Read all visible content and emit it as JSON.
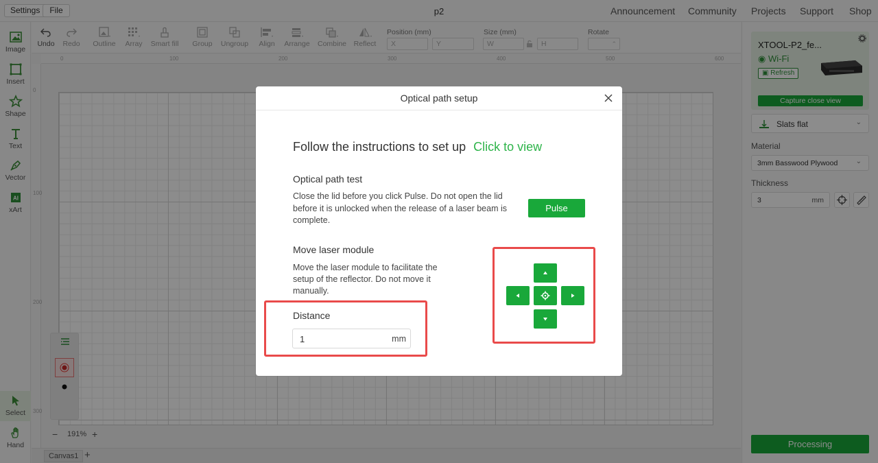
{
  "topbar": {
    "settings_label": "Settings",
    "file_label": "File",
    "title": "p2",
    "nav": [
      "Announcement",
      "Community",
      "Projects",
      "Support",
      "Shop"
    ]
  },
  "leftrail": {
    "tools": [
      {
        "label": "Image",
        "icon": "image-icon"
      },
      {
        "label": "Insert",
        "icon": "insert-icon"
      },
      {
        "label": "Shape",
        "icon": "shape-icon"
      },
      {
        "label": "Text",
        "icon": "text-icon"
      },
      {
        "label": "Vector",
        "icon": "vector-pen-icon"
      },
      {
        "label": "xArt",
        "icon": "ai-art-icon"
      }
    ],
    "bottom_tools": [
      {
        "label": "Select",
        "icon": "cursor-icon"
      },
      {
        "label": "Hand",
        "icon": "hand-icon"
      }
    ]
  },
  "toolbar": {
    "undo": "Undo",
    "redo": "Redo",
    "outline": "Outline",
    "array": "Array",
    "smart_fill": "Smart fill",
    "group": "Group",
    "ungroup": "Ungroup",
    "align": "Align",
    "arrange": "Arrange",
    "combine": "Combine",
    "reflect": "Reflect",
    "position_label": "Position (mm)",
    "position_x": "X",
    "position_y": "Y",
    "size_label": "Size (mm)",
    "size_w": "W",
    "size_h": "H",
    "rotate_label": "Rotate"
  },
  "rulers": {
    "h": [
      "0",
      "100",
      "200",
      "300",
      "400",
      "500",
      "600"
    ],
    "v": [
      "0",
      "100",
      "200",
      "300"
    ]
  },
  "canvas": {
    "zoom": "191%",
    "tab": "Canvas1"
  },
  "rightpanel": {
    "device_name": "XTOOL-P2_fe...",
    "connection": "Wi-Fi",
    "refresh": "Refresh",
    "capture": "Capture close view",
    "platform": "Slats flat",
    "material_label": "Material",
    "material_value": "3mm Basswood Plywood",
    "thickness_label": "Thickness",
    "thickness_value": "3",
    "thickness_unit": "mm",
    "processing": "Processing"
  },
  "modal": {
    "title": "Optical path setup",
    "instructions": "Follow the instructions to set up",
    "click_to_view": "Click to view",
    "test_heading": "Optical path test",
    "test_text": "Close the lid before you click Pulse. Do not open the lid before it is unlocked when the release of a laser beam is complete.",
    "pulse": "Pulse",
    "move_heading": "Move laser module",
    "move_text": "Move the laser module to facilitate the setup of the reflector. Do not move it manually.",
    "distance_label": "Distance",
    "distance_value": "1",
    "distance_unit": "mm"
  },
  "colors": {
    "accent": "#19a83a",
    "highlight": "#e94a4a"
  }
}
